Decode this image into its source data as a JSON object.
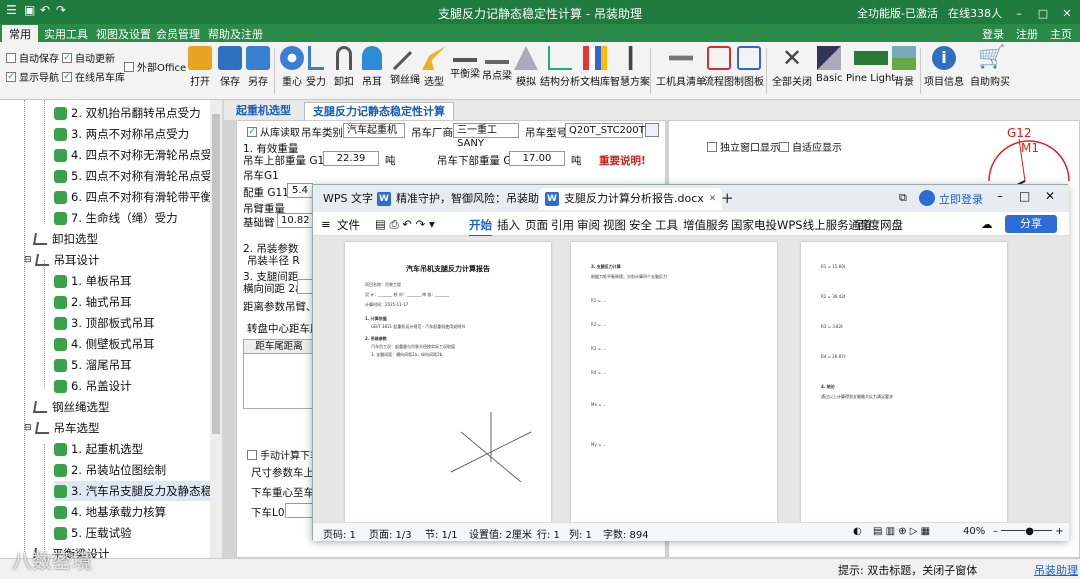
{
  "title_bar": {
    "title": "支腿反力记静态稳定性计算 - 吊装助理",
    "registration": "全功能版-已激活",
    "online": "在线338人",
    "quick_icons": [
      "menu-icon",
      "save-icon",
      "undo-icon",
      "redo-icon"
    ]
  },
  "menu": {
    "tabs": [
      "常用",
      "实用工具",
      "视图及设置",
      "会员管理",
      "帮助及注册"
    ],
    "account": [
      "登录",
      "注册",
      "主页"
    ]
  },
  "ribbon": {
    "checks": [
      {
        "label": "自动保存",
        "checked": false
      },
      {
        "label": "自动更新",
        "checked": true
      },
      {
        "label": "外部Office",
        "checked": false
      },
      {
        "label": "显示导航",
        "checked": true
      },
      {
        "label": "在线吊车库",
        "checked": true
      }
    ],
    "buttons": [
      "打开",
      "保存",
      "另存",
      "重心",
      "受力",
      "卸扣",
      "吊耳",
      "钢丝绳",
      "选型",
      "平衡梁",
      "吊点梁",
      "模拟",
      "结构分析",
      "文档库",
      "智慧方案",
      "工机具清单",
      "流程图",
      "制图板",
      "全部关闭",
      "Basic",
      "Pine Light",
      "背景",
      "项目信息",
      "自助购买"
    ]
  },
  "tree": [
    {
      "label": "2. 双机抬吊翻转吊点受力",
      "level": 2
    },
    {
      "label": "3. 两点不对称吊点受力",
      "level": 2
    },
    {
      "label": "4. 四点不对称无滑轮吊点受力",
      "level": 2
    },
    {
      "label": "5. 四点不对称有滑轮吊点受力",
      "level": 2
    },
    {
      "label": "6. 四点不对称有滑轮带平衡梁吊",
      "level": 2
    },
    {
      "label": "7. 生命线（绳）受力",
      "level": 2
    },
    {
      "label": "卸扣选型",
      "level": 1
    },
    {
      "label": "吊耳设计",
      "level": 1
    },
    {
      "label": "1. 单板吊耳",
      "level": 2
    },
    {
      "label": "2. 轴式吊耳",
      "level": 2
    },
    {
      "label": "3. 顶部板式吊耳",
      "level": 2
    },
    {
      "label": "4. 侧壁板式吊耳",
      "level": 2
    },
    {
      "label": "5. 溜尾吊耳",
      "level": 2
    },
    {
      "label": "6. 吊盖设计",
      "level": 2
    },
    {
      "label": "钢丝绳选型",
      "level": 1
    },
    {
      "label": "吊车选型",
      "level": 1
    },
    {
      "label": "1. 起重机选型",
      "level": 2
    },
    {
      "label": "2. 吊装站位图绘制",
      "level": 2
    },
    {
      "label": "3. 汽车吊支腿反力及静态稳定性",
      "level": 2
    },
    {
      "label": "4. 地基承载力核算",
      "level": 2
    },
    {
      "label": "5. 压载试验",
      "level": 2
    },
    {
      "label": "平衡梁设计",
      "level": 1
    }
  ],
  "doc_tabs": [
    "起重机选型",
    "支腿反力记静态稳定性计算"
  ],
  "form": {
    "from_library": "从库读取",
    "crane_type_label": "吊车类别",
    "crane_type": "汽车起重机",
    "maker_label": "吊车厂商",
    "maker": "三一重工SANY",
    "model_label": "吊车型号",
    "model": "Q20T_STC200T5",
    "sec1": "1. 有效重量",
    "upper_weight_label": "吊车上部重量 G1",
    "upper_weight": "22.39",
    "unit_t": "吨",
    "lower_weight_label": "吊车下部重量 G0",
    "lower_weight": "17.00",
    "important": "重要说明!",
    "g01_label": "吊车G1",
    "counter_label": "配重 G11",
    "counter_value": "5.4",
    "boom_label": "吊臂重量",
    "base_arm_label": "基础臂",
    "base_arm_value": "10.82",
    "sec2": "2. 吊装参数",
    "radius_label": "吊装半径 R",
    "sec3": "3. 支腿间距",
    "lateral_label": "横向间距 2a",
    "distance_params_label": "距离参数",
    "boom_short": "吊臂、",
    "turntable_label": "转盘中心距车尾",
    "table_header": "距车尾距离",
    "manual_calc": "手动计算下车",
    "size_params": "尺寸参数",
    "car_up": "车上",
    "center_label": "下车重心至车尾",
    "lower_l0": "下车L0"
  },
  "right_panel": {
    "independent": "独立窗口显示",
    "adaptive": "自适应显示",
    "g12": "G12",
    "m1": "M1"
  },
  "wps": {
    "tabs": [
      "WPS 文字",
      "精准守护，智御风险：吊装助理-支",
      "支腿反力计算分析报告.docx"
    ],
    "login": "立即登录",
    "file": "文件",
    "menus": [
      "开始",
      "插入",
      "页面",
      "引用",
      "审阅",
      "视图",
      "安全",
      "工具",
      "增值服务",
      "国家电投WPS线上服务通道",
      "百度网盘"
    ],
    "share": "分享",
    "page1": {
      "title": "汽车吊机支腿反力计算报告",
      "lines": [
        "项目名称：吊装工程",
        "设 计：_______ 校 对：_______ 审 核：_______",
        "计算时间：2025-11-17",
        "1. 计算依据",
        "GB/T 3811 起重机设计规范 · 汽车起重机使用说明书",
        "2. 吊装参数",
        "汽车吊工况：起重量与吊装半径按实际工况取值",
        "3. 支腿间距：横向间距2a，纵向间距2b"
      ]
    },
    "page2": {
      "lines": [
        "3. 支腿反力计算",
        "根据力矩平衡原理，分别计算四个支腿反力",
        "R1 = ...",
        "R2 = ...",
        "R3 = ...",
        "R4 = ...",
        "Mx = ...",
        "My = ..."
      ]
    },
    "page3": {
      "lines": [
        "R1 = 15.60t",
        "R2 = 36.43t",
        "R3 = 3.82t",
        "R4 = 26.87t",
        "4. 结论",
        "通过以上计算得到支腿最大反力满足要求"
      ]
    },
    "status": {
      "page": "页码: 1",
      "pages": "页面: 1/3",
      "section": "节: 1/1",
      "setting": "设置值: 2厘米",
      "row": "行: 1",
      "col": "列: 1",
      "words": "字数: 894",
      "zoom": "40%"
    }
  },
  "status_bar": {
    "hint": "提示: 双击标题，关闭子窗体",
    "link": "吊装助理"
  },
  "watermark": "八数密境"
}
